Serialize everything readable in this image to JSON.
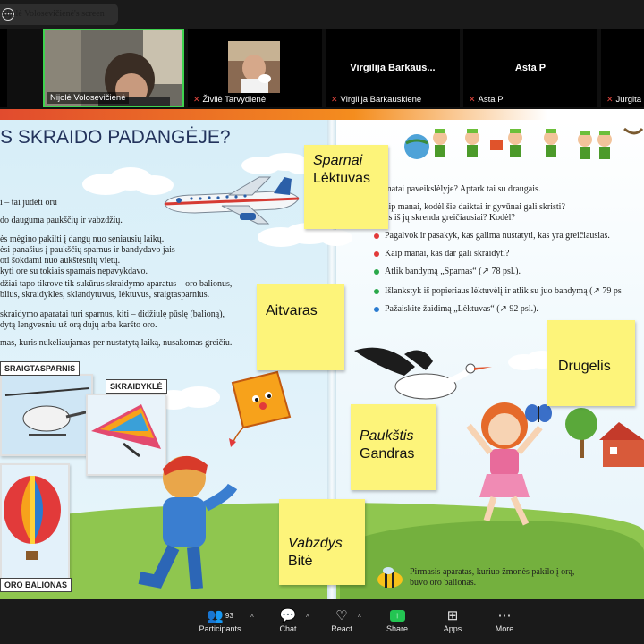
{
  "share_bar": {
    "label": "nijolė Volosevičienė's screen"
  },
  "participants": [
    {
      "name": "Nijolė Volosevičienė",
      "video": true,
      "active": true
    },
    {
      "name": "Živilė Tarvydienė",
      "video": true,
      "muted": true
    },
    {
      "name": "Virgilija Barkauskienė",
      "display": "Virgilija Barkaus...",
      "video": false,
      "muted": true
    },
    {
      "name": "Asta P",
      "display": "Asta P",
      "video": false,
      "muted": true
    },
    {
      "name": "Jurgita",
      "video": false,
      "muted": true
    }
  ],
  "slide": {
    "title": "S SKRAIDO PADANGĖJE?",
    "left_lines": [
      "i – tai judėti oru",
      "do dauguma paukščių ir vabzdžių.",
      "ės mėgino pakilti į dangų nuo seniausių laikų.",
      "ėsi panašius į paukščių sparnus ir bandydavo jais",
      "oti šokdami nuo aukštesnių vietų.",
      "kyti ore su tokiais sparnais nepavykdavo.",
      "džiai tapo tikrove tik sukūrus skraidymo aparatus – oro balionus,",
      "blius, skraidykles, sklandytuvus, lėktuvus, sraigtasparnius.",
      "skraidymo aparatai turi sparnus, kiti – didžiulę pūslę (balioną),",
      "dytą lengvesniu už orą dujų arba karšto oro.",
      "mas, kuris nukeliaujamas per nustatytą laiką, nusakomas greičiu."
    ],
    "right_lines": [
      "matai paveikslėlyje? Aptark tai su draugais.",
      "aip manai, kodėl šie daiktai ir gyvūnai gali skristi?",
      "as iš jų skrenda greičiausiai? Kodėl?"
    ],
    "bullets": [
      {
        "text": "Pagalvok ir pasakyk, kas galima nustatyti, kas yra greičiausias.",
        "color": "#e23a3a"
      },
      {
        "text": "Kaip manai, kas dar gali skraidyti?",
        "color": "#e23a3a"
      },
      {
        "text": "Atlik bandymą „Sparnas“ (↗ 78 psl.).",
        "color": "#2aa84a"
      },
      {
        "text": "Išlankstyk iš popieriaus lėktuvėlį ir atlik su juo bandymą (↗ 79 ps",
        "color": "#2aa84a"
      },
      {
        "text": "Pažaiskite žaidimą „Lėktuvas“ (↗ 92 psl.).",
        "color": "#2a7bd0"
      }
    ],
    "labels": {
      "helicopter": "SRAIGTASPARNIS",
      "hangglider": "SKRAIDYKLĖ",
      "balloon": "ORO BALIONAS"
    },
    "footer_note_1": "Pirmasis aparatas, kuriuo žmonės pakilo į orą,",
    "footer_note_2": "buvo oro balionas."
  },
  "stickies": [
    {
      "line1": "Sparnai",
      "line2": "Lėktuvas",
      "italic_first": true
    },
    {
      "line1": "Aitvaras"
    },
    {
      "line1": "Drugelis"
    },
    {
      "line1": "Paukštis",
      "line2": "Gandras",
      "italic_first": true
    },
    {
      "line1": "Vabzdys",
      "line2": "Bitė",
      "italic_first": true
    }
  ],
  "toolbar": [
    {
      "label": "Participants",
      "icon": "participants-icon",
      "count": "93"
    },
    {
      "label": "Chat",
      "icon": "chat-icon"
    },
    {
      "label": "React",
      "icon": "heart-icon"
    },
    {
      "label": "Share",
      "icon": "share-screen-icon"
    },
    {
      "label": "Apps",
      "icon": "apps-icon"
    },
    {
      "label": "More",
      "icon": "more-icon"
    }
  ],
  "colors": {
    "share_green": "#23c552",
    "muted_red": "#e0463e",
    "sticky_yellow": "#fdf47a",
    "active_tile": "#3fd34f"
  }
}
